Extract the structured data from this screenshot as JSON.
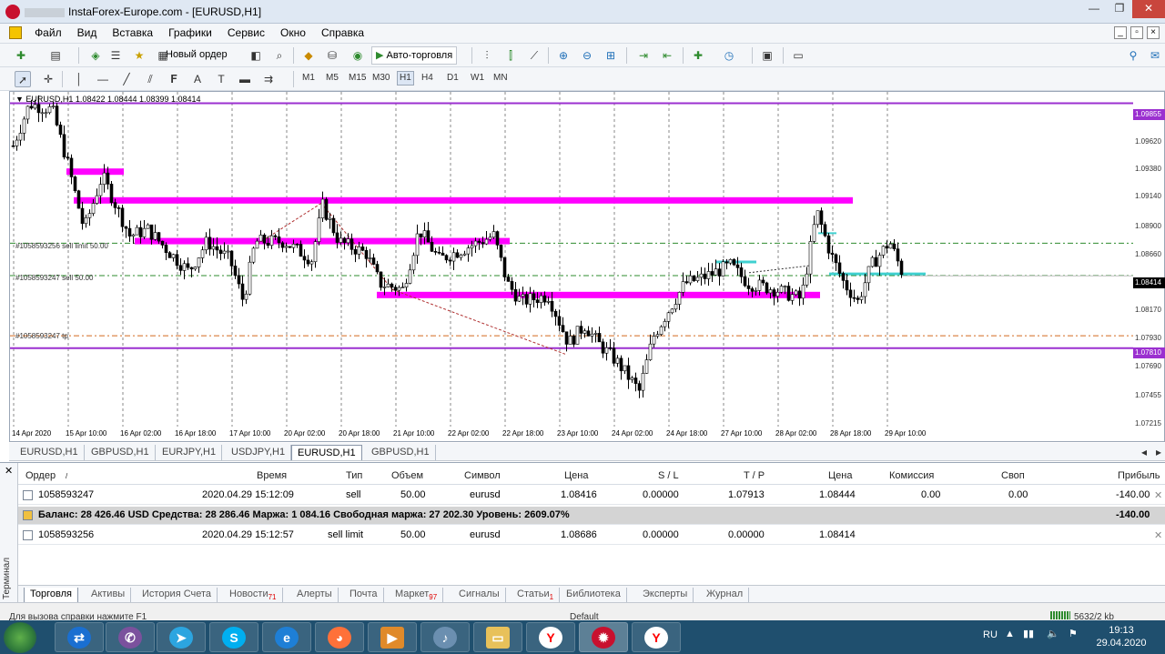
{
  "window": {
    "title": "InstaForex-Europe.com - [EURUSD,H1]",
    "controls": [
      "—",
      "❐",
      "✕"
    ]
  },
  "menu": [
    "Файл",
    "Вид",
    "Вставка",
    "Графики",
    "Сервис",
    "Окно",
    "Справка"
  ],
  "toolbar": {
    "new_order": "Новый ордер",
    "autotrading": "Авто-торговля"
  },
  "timeframes": [
    "M1",
    "M5",
    "M15",
    "M30",
    "H1",
    "H4",
    "D1",
    "W1",
    "MN"
  ],
  "active_timeframe": "H1",
  "chart": {
    "header": "EURUSD,H1  1.08422 1.08444 1.08399 1.08414",
    "price_ticks": [
      "1.09620",
      "1.09380",
      "1.09140",
      "1.08900",
      "1.08660",
      "1.08170",
      "1.07930",
      "1.07690",
      "1.07455",
      "1.07215"
    ],
    "price_tags": {
      "top": "1.09855",
      "current": "1.08414",
      "bottom": "1.07810"
    },
    "dates": [
      "14 Apr 2020",
      "15 Apr 10:00",
      "16 Apr 02:00",
      "16 Apr 18:00",
      "17 Apr 10:00",
      "20 Apr 02:00",
      "20 Apr 18:00",
      "21 Apr 10:00",
      "22 Apr 02:00",
      "22 Apr 18:00",
      "23 Apr 10:00",
      "24 Apr 02:00",
      "24 Apr 18:00",
      "27 Apr 10:00",
      "28 Apr 02:00",
      "28 Apr 18:00",
      "29 Apr 10:00"
    ],
    "order_labels": [
      "#1058593256 sell limit 50.00",
      "#1058593247 sell 50.00",
      "#1058593247 tp"
    ],
    "colors": {
      "bull": "#000000",
      "bear": "#000000",
      "level_purple": "#9b30d0",
      "zone_magenta": "#ff00ff",
      "entry_green": "#2e8b2e",
      "tp_orange": "#d2691e",
      "cyan": "#40d0d0"
    }
  },
  "chart_tabs": [
    "EURUSD,H1",
    "GBPUSD,H1",
    "EURJPY,H1",
    "USDJPY,H1",
    "EURUSD,H1",
    "GBPUSD,H1"
  ],
  "active_chart_tab": 4,
  "terminal": {
    "side_label": "Терминал",
    "columns": [
      "Ордер",
      "/",
      "Время",
      "Тип",
      "Объем",
      "Символ",
      "Цена",
      "S / L",
      "T / P",
      "Цена",
      "Комиссия",
      "Своп",
      "Прибыль"
    ],
    "rows": [
      {
        "order": "1058593247",
        "time": "2020.04.29 15:12:09",
        "type": "sell",
        "volume": "50.00",
        "symbol": "eurusd",
        "price": "1.08416",
        "sl": "0.00000",
        "tp": "1.07913",
        "cur_price": "1.08444",
        "commission": "0.00",
        "swap": "0.00",
        "profit": "-140.00"
      },
      {
        "order": "1058593256",
        "time": "2020.04.29 15:12:57",
        "type": "sell limit",
        "volume": "50.00",
        "symbol": "eurusd",
        "price": "1.08686",
        "sl": "0.00000",
        "tp": "0.00000",
        "cur_price": "1.08414",
        "commission": "",
        "swap": "",
        "profit": ""
      }
    ],
    "balance_line": "Баланс: 28 426.46 USD  Средства: 28 286.46  Маржа: 1 084.16  Свободная маржа: 27 202.30  Уровень: 2609.07%",
    "balance_profit": "-140.00",
    "tabs": [
      {
        "label": "Торговля",
        "badge": ""
      },
      {
        "label": "Активы",
        "badge": ""
      },
      {
        "label": "История Счета",
        "badge": ""
      },
      {
        "label": "Новости",
        "badge": "71"
      },
      {
        "label": "Алерты",
        "badge": ""
      },
      {
        "label": "Почта",
        "badge": ""
      },
      {
        "label": "Маркет",
        "badge": "97"
      },
      {
        "label": "Сигналы",
        "badge": ""
      },
      {
        "label": "Статьи",
        "badge": "1"
      },
      {
        "label": "Библиотека",
        "badge": ""
      },
      {
        "label": "Эксперты",
        "badge": ""
      },
      {
        "label": "Журнал",
        "badge": ""
      }
    ]
  },
  "status": {
    "help": "Для вызова справки нажмите F1",
    "profile": "Default",
    "traffic": "5632/2 kb"
  },
  "taskbar": {
    "apps": [
      "teamviewer-icon",
      "viber-icon",
      "telegram-icon",
      "skype-icon",
      "ie-icon",
      "firefox-icon",
      "media-player-icon",
      "volume-app-icon",
      "explorer-icon",
      "yandex-icon",
      "mt4-icon",
      "yandex-browser-icon"
    ],
    "lang": "RU",
    "time": "19:13",
    "date": "29.04.2020"
  }
}
